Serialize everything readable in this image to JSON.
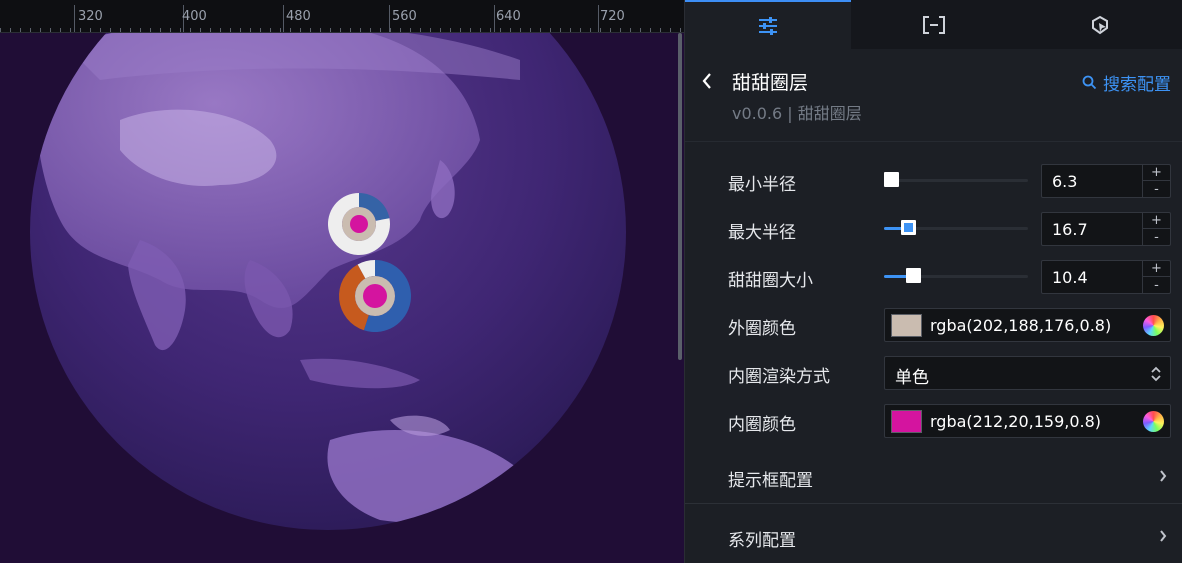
{
  "ruler": {
    "labels": [
      "320",
      "400",
      "480",
      "560",
      "640",
      "720"
    ]
  },
  "tabs": [
    {
      "name": "style",
      "icon": "sliders-icon",
      "active": true
    },
    {
      "name": "data",
      "icon": "bracket-icon",
      "active": false
    },
    {
      "name": "interaction",
      "icon": "cursor-click-icon",
      "active": false
    }
  ],
  "header": {
    "title": "甜甜圈层",
    "subtitle": "v0.0.6 | 甜甜圈层",
    "search_label": "搜索配置"
  },
  "fields": {
    "min_radius": {
      "label": "最小半径",
      "value": "6.3",
      "slider_fraction": 0.05
    },
    "max_radius": {
      "label": "最大半径",
      "value": "16.7",
      "slider_fraction": 0.17
    },
    "donut_size": {
      "label": "甜甜圈大小",
      "value": "10.4",
      "slider_fraction": 0.2
    },
    "outer_color": {
      "label": "外圈颜色",
      "value": "rgba(202,188,176,0.8)",
      "swatch": "#cabcb0"
    },
    "inner_render_mode": {
      "label": "内圈渲染方式",
      "value": "单色"
    },
    "inner_color": {
      "label": "内圈颜色",
      "value": "rgba(212,20,159,0.8)",
      "swatch": "#d4149f"
    }
  },
  "sections": {
    "tooltip": {
      "label": "提示框配置"
    },
    "series": {
      "label": "系列配置"
    }
  },
  "colors": {
    "accent": "#3d93f5",
    "canvas_bg": "#200d36",
    "panel_bg": "#1c1f25"
  },
  "donuts": [
    {
      "segments": [
        0.22,
        0.78
      ],
      "colors": [
        "#3563a6",
        "#eeeeee"
      ]
    },
    {
      "segments": [
        0.55,
        0.37,
        0.08
      ],
      "colors": [
        "#2f5fae",
        "#c65a1e",
        "#eeeeee"
      ]
    }
  ]
}
